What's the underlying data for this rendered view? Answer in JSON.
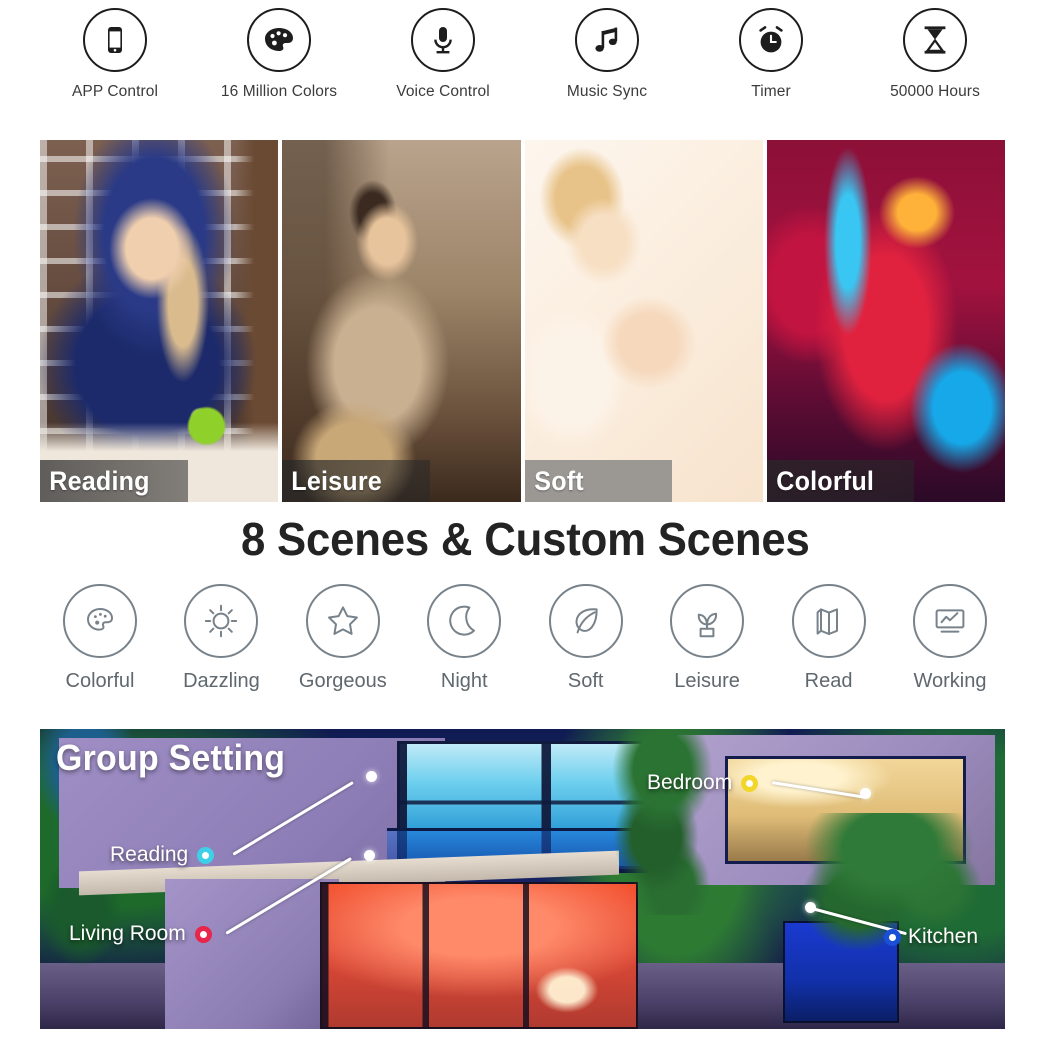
{
  "features": [
    {
      "icon": "phone-icon",
      "label": "APP Control"
    },
    {
      "icon": "palette-icon",
      "label": "16 Million Colors"
    },
    {
      "icon": "microphone-icon",
      "label": "Voice Control"
    },
    {
      "icon": "music-note-icon",
      "label": "Music Sync"
    },
    {
      "icon": "alarm-clock-icon",
      "label": "Timer"
    },
    {
      "icon": "hourglass-icon",
      "label": "50000 Hours"
    }
  ],
  "photos": [
    {
      "label": "Reading",
      "bar": "dark"
    },
    {
      "label": "Leisure",
      "bar": "dark"
    },
    {
      "label": "Soft",
      "bar": "light"
    },
    {
      "label": "Colorful",
      "bar": "dark"
    }
  ],
  "headline": "8 Scenes & Custom Scenes",
  "scenes": [
    {
      "icon": "palette-outline-icon",
      "label": "Colorful"
    },
    {
      "icon": "sun-outline-icon",
      "label": "Dazzling"
    },
    {
      "icon": "star-outline-icon",
      "label": "Gorgeous"
    },
    {
      "icon": "moon-outline-icon",
      "label": "Night"
    },
    {
      "icon": "leaf-outline-icon",
      "label": "Soft"
    },
    {
      "icon": "plant-outline-icon",
      "label": "Leisure"
    },
    {
      "icon": "book-outline-icon",
      "label": "Read"
    },
    {
      "icon": "monitor-outline-icon",
      "label": "Working"
    }
  ],
  "group": {
    "title": "Group Setting",
    "callouts": [
      {
        "label": "Reading",
        "color": "#3fd0e8"
      },
      {
        "label": "Living Room",
        "color": "#e8254a"
      },
      {
        "label": "Bedroom",
        "color": "#f2d72a"
      },
      {
        "label": "Kitchen",
        "color": "#1a4fd8"
      }
    ]
  }
}
